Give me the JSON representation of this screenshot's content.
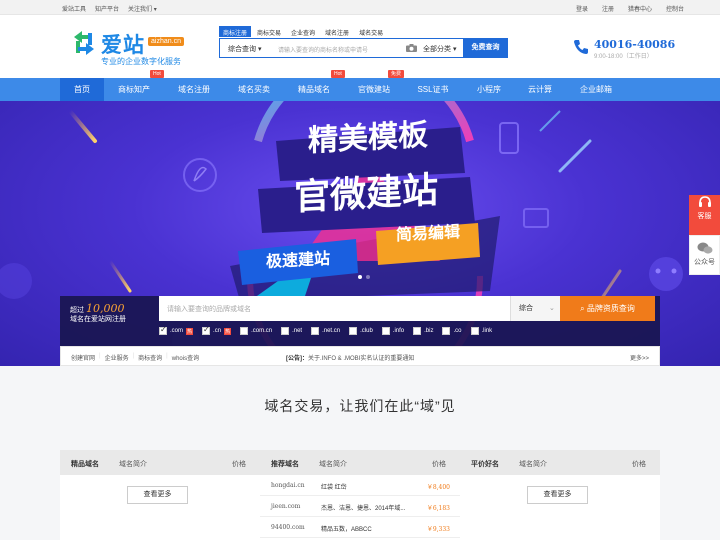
{
  "topbar": {
    "left": [
      "爱站工具",
      "知产平台",
      "关注我们 ▾"
    ],
    "right": [
      "登录",
      "注册",
      "猎春中心",
      "控制台"
    ]
  },
  "logo": {
    "name": "爱站",
    "domain": "aizhan.cn",
    "slogan": "专业的企业数字化服务"
  },
  "search": {
    "tabs": [
      "商标注册",
      "商标交易",
      "企业查询",
      "域名注册",
      "域名交易"
    ],
    "type": "综合查询",
    "placeholder": "请输入要查询的商标名称或申请号",
    "category": "全部分类",
    "button": "免费查询"
  },
  "phone": {
    "number": "40016-40086",
    "hours": "9:00-18:00（工作日）"
  },
  "nav": {
    "items": [
      "首页",
      "商标知产",
      "域名注册",
      "域名买卖",
      "精品域名",
      "官微建站",
      "SSL证书",
      "小程序",
      "云计算",
      "企业邮箱"
    ],
    "badges": [
      "Hot",
      "Hot",
      "免费"
    ]
  },
  "banner": {
    "line1": "精美模板",
    "line2": "官微建站",
    "tag1": "极速建站",
    "tag2": "简易编辑"
  },
  "domain_search": {
    "prefix": "超过",
    "count": "10,000",
    "suffix": "域名在爱站网注册",
    "placeholder": "请输入要查询的品牌或域名",
    "select": "综合",
    "button": "品牌资质查询",
    "hot": "热",
    "tlds": [
      ".com",
      ".cn",
      ".com.cn",
      ".net",
      ".net.cn",
      ".club",
      ".info",
      ".biz",
      ".co",
      ".link"
    ],
    "checked": [
      true,
      true,
      false,
      false,
      false,
      false,
      false,
      false,
      false,
      false
    ],
    "hot_flags": [
      true,
      true,
      false,
      false,
      false,
      false,
      false,
      false,
      false,
      false
    ]
  },
  "news": {
    "links": [
      "创建官网",
      "企业服务",
      "商标查询",
      "whois查询"
    ],
    "notice_label": "[公告]：",
    "notice": "关于.INFO & .MOBI实名认证的重要通知",
    "more": "更多>>"
  },
  "float": {
    "service": "客服",
    "wechat": "公众号"
  },
  "section_title": "域名交易，让我们在此“域”见",
  "panels": [
    {
      "title": "精品域名",
      "col2": "域名简介",
      "col3": "价格",
      "more": "查看更多",
      "rows": []
    },
    {
      "title": "推荐域名",
      "col2": "域名简介",
      "col3": "价格",
      "more": "",
      "rows": [
        {
          "domain": "hongdai.cn",
          "intro": "红袋 红岱",
          "price": "￥8,400"
        },
        {
          "domain": "jieen.com",
          "intro": "杰恩、洁恩、捷恩、2014年域...",
          "price": "￥6,183"
        },
        {
          "domain": "94400.com",
          "intro": "精品五数，ABBCC",
          "price": "￥9,333"
        }
      ]
    },
    {
      "title": "平价好名",
      "col2": "域名简介",
      "col3": "价格",
      "more": "查看更多",
      "rows": []
    }
  ],
  "colors": {
    "primary": "#1f6ad8",
    "nav": "#3d8ae8",
    "accent": "#f07b1a",
    "hot": "#f24b3c"
  }
}
